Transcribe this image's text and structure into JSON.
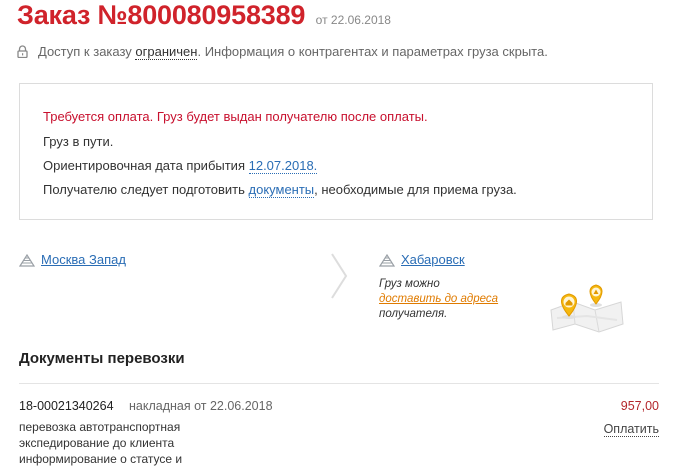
{
  "order": {
    "title": "Заказ №800080958389",
    "date": "от 22.06.2018"
  },
  "access": {
    "prefix": "Доступ к заказу ",
    "status": "ограничен",
    "suffix": ". Информация о контрагентах и параметрах груза скрыта."
  },
  "status": {
    "payment_required": "Требуется оплата. Груз будет выдан получателю после оплаты.",
    "in_transit": "Груз в пути.",
    "arrival_prefix": "Ориентировочная дата прибытия ",
    "arrival_date": "12.07.2018.",
    "docs_prefix": "Получателю следует подготовить ",
    "docs_link": "документы",
    "docs_suffix": ", необходимые для приема груза."
  },
  "route": {
    "from": "Москва Запад",
    "to": "Хабаровск",
    "delivery_prefix": "Груз можно",
    "delivery_link": "доставить до адреса",
    "delivery_suffix": "получателя."
  },
  "documents": {
    "title": "Документы перевозки",
    "items": [
      {
        "number": "18-00021340264",
        "meta": "накладная от 22.06.2018",
        "amount": "957,00",
        "pay_label": "Оплатить",
        "services": [
          "перевозка автотранспортная",
          "экспедирование до клиента",
          "информирование о статусе и"
        ]
      }
    ]
  },
  "icons": {
    "lock": "lock-icon",
    "terminal": "terminal-icon",
    "chevron": "chevron-right-icon",
    "map": "map-pins-illustration"
  },
  "colors": {
    "title_red": "#d0232b",
    "warning_red": "#c8102e",
    "link_blue": "#2a6db5",
    "delivery_orange": "#e07b00",
    "amount_red": "#b3262b"
  }
}
